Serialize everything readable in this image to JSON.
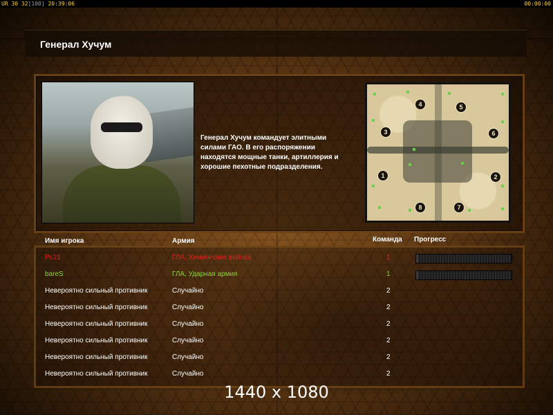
{
  "status_bar": {
    "left_prefix": "UR",
    "left_values": "30 32",
    "left_bracket": "[100]",
    "left_time": "20:39:06",
    "right_time": "00:00:00"
  },
  "title": "Генерал Хучум",
  "description": "Генерал Хучум командует элитными\n   силами ГАО. В его распоряжении\n   находятся мощные танки, артиллерия и\n   хорошие пехотные подразделения.",
  "minimap": {
    "spots": [
      "4",
      "5",
      "3",
      "6",
      "1",
      "2",
      "8",
      "7"
    ]
  },
  "table": {
    "headers": {
      "player": "Имя игрока",
      "army": "Армия",
      "team": "Команда",
      "progress": "Прогресс"
    },
    "rows": [
      {
        "name": "Pc21",
        "army": "ГЛА, Химические войска",
        "team": "1",
        "color": "#e02020",
        "progress": true
      },
      {
        "name": "bareS",
        "army": "ГЛА, Ударная армия",
        "team": "1",
        "color": "#8cd23c",
        "progress": true
      },
      {
        "name": "Невероятно сильный противник",
        "army": "Случайно",
        "team": "2",
        "color": "#ffffff",
        "progress": false
      },
      {
        "name": "Невероятно сильный противник",
        "army": "Случайно",
        "team": "2",
        "color": "#ffffff",
        "progress": false
      },
      {
        "name": "Невероятно сильный противник",
        "army": "Случайно",
        "team": "2",
        "color": "#ffffff",
        "progress": false
      },
      {
        "name": "Невероятно сильный противник",
        "army": "Случайно",
        "team": "2",
        "color": "#ffffff",
        "progress": false
      },
      {
        "name": "Невероятно сильный противник",
        "army": "Случайно",
        "team": "2",
        "color": "#ffffff",
        "progress": false
      },
      {
        "name": "Невероятно сильный противник",
        "army": "Случайно",
        "team": "2",
        "color": "#ffffff",
        "progress": false
      }
    ]
  },
  "resolution_label": "1440 x 1080",
  "colors": {
    "status_text": "#ffd23c",
    "player_red": "#e02020",
    "player_green": "#8cd23c"
  }
}
